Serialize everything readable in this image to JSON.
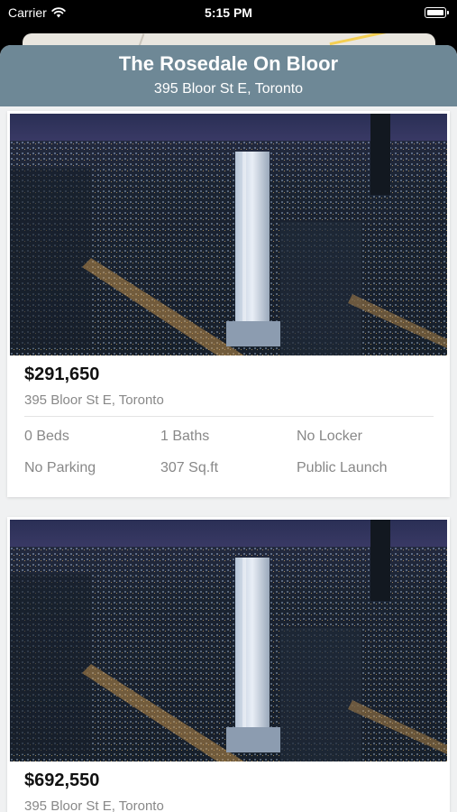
{
  "status_bar": {
    "carrier": "Carrier",
    "time": "5:15 PM"
  },
  "header": {
    "title": "The Rosedale On Bloor",
    "subtitle": "395 Bloor St E, Toronto",
    "color": "#6e8896"
  },
  "listings": [
    {
      "price": "$291,650",
      "address": "395 Bloor St E, Toronto",
      "beds": "0 Beds",
      "baths": "1 Baths",
      "locker": "No Locker",
      "parking": "No Parking",
      "size": "307 Sq.ft",
      "status": "Public Launch"
    },
    {
      "price": "$692,550",
      "address": "395 Bloor St E, Toronto"
    }
  ]
}
